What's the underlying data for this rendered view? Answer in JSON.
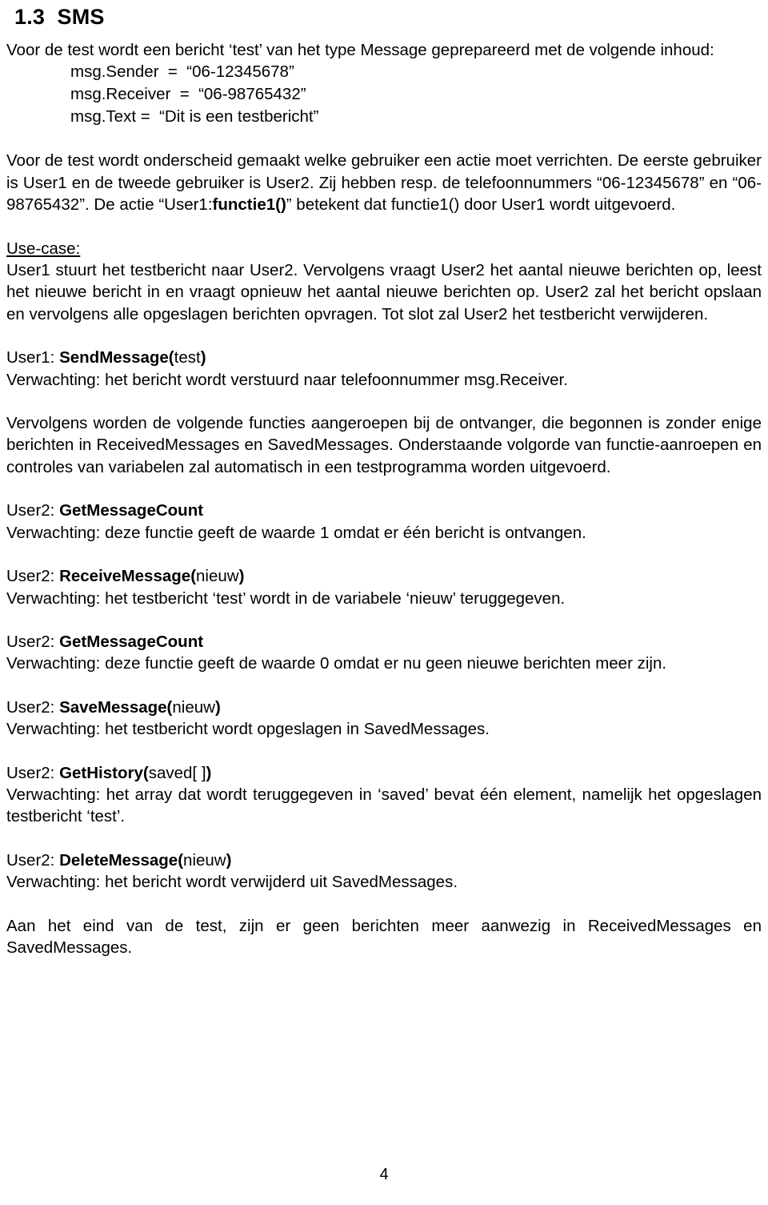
{
  "document": {
    "heading": "1.3  SMS",
    "page_number": "4"
  },
  "intro": {
    "paragraph": "Voor de test wordt een bericht ‘test’ van het type Message geprepareerd met de volgende inhoud:",
    "fields": [
      "msg.Sender  =  “06-12345678”",
      "msg.Receiver  =  “06-98765432”",
      "msg.Text =  “Dit is een testbericht”"
    ]
  },
  "users_paragraph": {
    "part1": "Voor de test wordt onderscheid gemaakt welke gebruiker een actie moet verrichten. De eerste gebruiker is User1 en de tweede gebruiker is User2. Zij hebben resp. de telefoonnummers “06-12345678” en “06-98765432”. De actie “User1:",
    "bold_fn": "functie1()",
    "part2": "” betekent dat functie1() door User1 wordt uitgevoerd."
  },
  "usecase": {
    "label": "Use-case:",
    "paragraph": "User1 stuurt het testbericht naar User2. Vervolgens vraagt User2 het aantal nieuwe berichten op, leest het nieuwe bericht in en vraagt opnieuw het aantal nieuwe berichten op. User2 zal het bericht opslaan en vervolgens alle opgeslagen berichten opvragen. Tot slot zal User2 het testbericht verwijderen."
  },
  "automation_paragraph": "Vervolgens worden de volgende functies aangeroepen bij de ontvanger, die begonnen is zonder enige berichten in ReceivedMessages en SavedMessages. Onderstaande volgorde van functie-aanroepen en controles van variabelen zal automatisch in een testprogramma worden uitgevoerd.",
  "steps": [
    {
      "actor": "User1: ",
      "fn": "SendMessage(",
      "arg": "test",
      "close": ")",
      "expectation": "Verwachting: het bericht wordt verstuurd naar telefoonnummer msg.Receiver."
    },
    {
      "actor": "User2: ",
      "fn": "GetMessageCount",
      "arg": "",
      "close": "",
      "expectation": "Verwachting: deze functie geeft de waarde 1 omdat er één bericht is ontvangen."
    },
    {
      "actor": "User2: ",
      "fn": "ReceiveMessage(",
      "arg": "nieuw",
      "close": ")",
      "expectation": "Verwachting: het testbericht ‘test’ wordt in de variabele ‘nieuw’ teruggegeven."
    },
    {
      "actor": "User2: ",
      "fn": "GetMessageCount",
      "arg": "",
      "close": "",
      "expectation": "Verwachting: deze functie geeft de waarde 0 omdat er nu geen nieuwe berichten meer zijn."
    },
    {
      "actor": "User2: ",
      "fn": "SaveMessage(",
      "arg": "nieuw",
      "close": ")",
      "expectation": "Verwachting: het testbericht wordt opgeslagen in SavedMessages."
    },
    {
      "actor": "User2: ",
      "fn": "GetHistory(",
      "arg": "saved[ ]",
      "close": ")",
      "expectation": "Verwachting: het array dat wordt teruggegeven in ‘saved’ bevat één element, namelijk het opgeslagen testbericht ‘test’."
    },
    {
      "actor": "User2: ",
      "fn": "DeleteMessage(",
      "arg": "nieuw",
      "close": ")",
      "expectation": "Verwachting: het bericht wordt verwijderd uit SavedMessages."
    }
  ],
  "closing_paragraph": "Aan het eind van de test, zijn er geen berichten meer aanwezig in ReceivedMessages en SavedMessages."
}
